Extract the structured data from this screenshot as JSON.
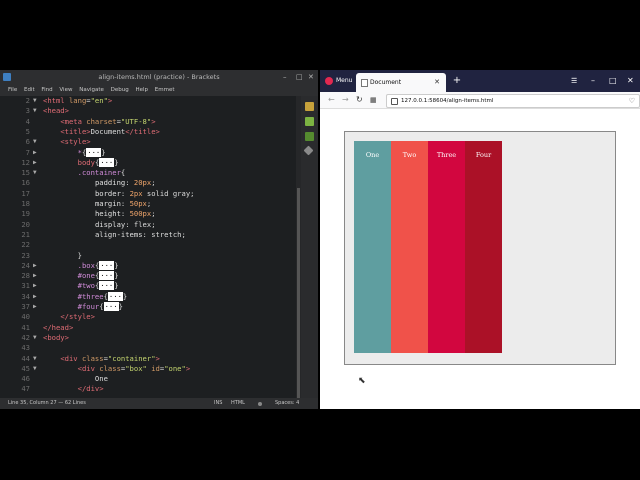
{
  "editor": {
    "title": "align-items.html (practice) - Brackets",
    "menu": [
      "File",
      "Edit",
      "Find",
      "View",
      "Navigate",
      "Debug",
      "Help",
      "Emmet"
    ],
    "status": {
      "position": "Line 35, Column 27 — 62 Lines",
      "mode": "INS",
      "lang": "HTML",
      "spaces": "Spaces: 4"
    },
    "lines": [
      {
        "n": "2",
        "f": "▼",
        "html": "<span class=\"tag\">&lt;html</span> <span class=\"attr\">lang</span>=<span class=\"str\">\"en\"</span><span class=\"tag\">&gt;</span>"
      },
      {
        "n": "3",
        "f": "▼",
        "html": "<span class=\"tag\">&lt;head&gt;</span>"
      },
      {
        "n": "4",
        "f": "",
        "html": "    <span class=\"tag\">&lt;meta</span> <span class=\"attr\">charset</span>=<span class=\"str\">\"UTF-8\"</span><span class=\"tag\">&gt;</span>"
      },
      {
        "n": "5",
        "f": "",
        "html": "    <span class=\"tag\">&lt;title&gt;</span>Document<span class=\"tag\">&lt;/title&gt;</span>"
      },
      {
        "n": "6",
        "f": "▼",
        "html": "    <span class=\"tag\">&lt;style&gt;</span>"
      },
      {
        "n": "7",
        "f": "▶",
        "html": "        <span class=\"sel\">*</span>{<span class=\"coll\">···</span>}"
      },
      {
        "n": "12",
        "f": "▶",
        "html": "        <span class=\"tag\">body</span>{<span class=\"coll\">···</span>}"
      },
      {
        "n": "15",
        "f": "▼",
        "html": "        <span class=\"sel\">.container</span>{"
      },
      {
        "n": "16",
        "f": "",
        "html": "            <span class=\"prop\">padding</span>: <span class=\"num\">20px</span>;"
      },
      {
        "n": "17",
        "f": "",
        "html": "            <span class=\"prop\">border</span>: <span class=\"num\">2px</span> solid gray;"
      },
      {
        "n": "18",
        "f": "",
        "html": "            <span class=\"prop\">margin</span>: <span class=\"num\">50px</span>;"
      },
      {
        "n": "19",
        "f": "",
        "html": "            <span class=\"prop\">height</span>: <span class=\"num\">500px</span>;"
      },
      {
        "n": "20",
        "f": "",
        "html": "            <span class=\"prop\">display</span>: flex;"
      },
      {
        "n": "21",
        "f": "",
        "html": "            <span class=\"prop\">align-items</span>: stretch;"
      },
      {
        "n": "22",
        "f": "",
        "html": ""
      },
      {
        "n": "23",
        "f": "",
        "html": "        }"
      },
      {
        "n": "24",
        "f": "▶",
        "html": "        <span class=\"sel\">.box</span>{<span class=\"coll\">···</span>}"
      },
      {
        "n": "28",
        "f": "▶",
        "html": "        <span class=\"sel\">#one</span>{<span class=\"coll\">···</span>}"
      },
      {
        "n": "31",
        "f": "▶",
        "html": "        <span class=\"sel\">#two</span>{<span class=\"coll\">···</span>}"
      },
      {
        "n": "34",
        "f": "▶",
        "html": "        <span class=\"sel\">#three</span>{<span class=\"coll\">···</span>}"
      },
      {
        "n": "37",
        "f": "▶",
        "html": "        <span class=\"sel\">#four</span>{<span class=\"coll\">···</span>}"
      },
      {
        "n": "40",
        "f": "",
        "html": "    <span class=\"tag\">&lt;/style&gt;</span>"
      },
      {
        "n": "41",
        "f": "",
        "html": "<span class=\"tag\">&lt;/head&gt;</span>"
      },
      {
        "n": "42",
        "f": "▼",
        "html": "<span class=\"tag\">&lt;body&gt;</span>"
      },
      {
        "n": "43",
        "f": "",
        "html": ""
      },
      {
        "n": "44",
        "f": "▼",
        "html": "    <span class=\"tag\">&lt;div</span> <span class=\"attr\">class</span>=<span class=\"str\">\"container\"</span><span class=\"tag\">&gt;</span>"
      },
      {
        "n": "45",
        "f": "▼",
        "html": "        <span class=\"tag\">&lt;div</span> <span class=\"attr\">class</span>=<span class=\"str\">\"box\"</span> <span class=\"attr\">id</span>=<span class=\"str\">\"one\"</span><span class=\"tag\">&gt;</span>"
      },
      {
        "n": "46",
        "f": "",
        "html": "            One"
      },
      {
        "n": "47",
        "f": "",
        "html": "        <span class=\"tag\">&lt;/div&gt;</span>"
      }
    ]
  },
  "browser": {
    "menu_label": "Menu",
    "tab_title": "Document",
    "url": "127.0.0.1:58604/align-items.html",
    "boxes": [
      {
        "label": "One",
        "color": "#5f9ea0"
      },
      {
        "label": "Two",
        "color": "#f0524a"
      },
      {
        "label": "Three",
        "color": "#d2063f"
      },
      {
        "label": "Four",
        "color": "#ab1127"
      }
    ]
  }
}
